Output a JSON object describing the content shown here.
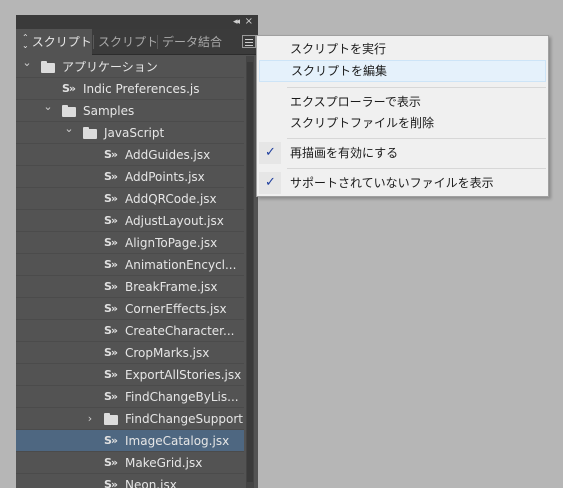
{
  "panel": {
    "tabs": [
      {
        "label": "スクリプト",
        "active": true
      },
      {
        "label": "スクリプトラ",
        "active": false
      },
      {
        "label": "データ結合",
        "active": false
      }
    ]
  },
  "tree": [
    {
      "label": "アプリケーション",
      "type": "folder",
      "level": 0,
      "chevron": "down"
    },
    {
      "label": "Indic Preferences.js",
      "type": "script",
      "level": 1
    },
    {
      "label": "Samples",
      "type": "folder",
      "level": 1,
      "chevron": "down"
    },
    {
      "label": "JavaScript",
      "type": "folder",
      "level": 2,
      "chevron": "down"
    },
    {
      "label": "AddGuides.jsx",
      "type": "script",
      "level": 3
    },
    {
      "label": "AddPoints.jsx",
      "type": "script",
      "level": 3
    },
    {
      "label": "AddQRCode.jsx",
      "type": "script",
      "level": 3
    },
    {
      "label": "AdjustLayout.jsx",
      "type": "script",
      "level": 3
    },
    {
      "label": "AlignToPage.jsx",
      "type": "script",
      "level": 3
    },
    {
      "label": "AnimationEncycl...",
      "type": "script",
      "level": 3
    },
    {
      "label": "BreakFrame.jsx",
      "type": "script",
      "level": 3
    },
    {
      "label": "CornerEffects.jsx",
      "type": "script",
      "level": 3
    },
    {
      "label": "CreateCharacter...",
      "type": "script",
      "level": 3
    },
    {
      "label": "CropMarks.jsx",
      "type": "script",
      "level": 3
    },
    {
      "label": "ExportAllStories.jsx",
      "type": "script",
      "level": 3
    },
    {
      "label": "FindChangeByLis...",
      "type": "script",
      "level": 3
    },
    {
      "label": "FindChangeSupport",
      "type": "folder",
      "level": 3,
      "chevron": "right"
    },
    {
      "label": "ImageCatalog.jsx",
      "type": "script",
      "level": 3,
      "selected": true
    },
    {
      "label": "MakeGrid.jsx",
      "type": "script",
      "level": 3
    },
    {
      "label": "Neon.jsx",
      "type": "script",
      "level": 3
    }
  ],
  "context_menu": {
    "items": [
      {
        "label": "スクリプトを実行",
        "checked": false
      },
      {
        "label": "スクリプトを編集",
        "checked": false,
        "hover": true
      },
      {
        "label": "エクスプローラーで表示",
        "checked": false
      },
      {
        "label": "スクリプトファイルを削除",
        "checked": false
      },
      {
        "label": "再描画を有効にする",
        "checked": true
      },
      {
        "label": "サポートされていないファイルを表示",
        "checked": true
      }
    ]
  },
  "icons": {
    "panel_collapse": "double-chevron-left-icon",
    "panel_close": "close-icon",
    "panel_menu": "hamburger-menu-icon",
    "folder": "folder-icon",
    "script": "script-icon",
    "check": "checkmark-icon"
  },
  "colors": {
    "panel_bg": "#535353",
    "selected_row": "#4e6781",
    "menu_bg": "#f0f0f0",
    "menu_hover": "#e5f1fb",
    "check": "#1f3f9e"
  }
}
